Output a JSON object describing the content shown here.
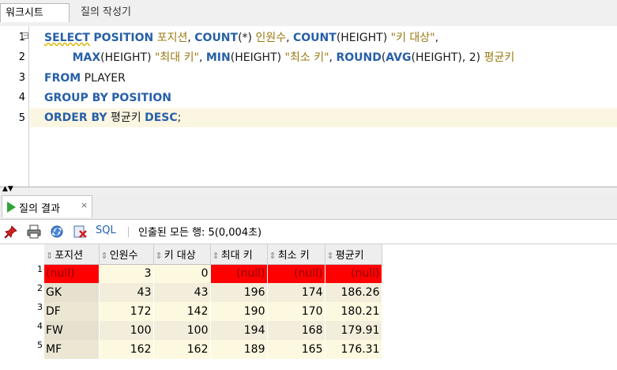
{
  "tabs": {
    "worksheet": "워크시트",
    "query_builder": "질의 작성기"
  },
  "editor": {
    "line_numbers": [
      "1",
      "2",
      "3",
      "4",
      "5"
    ],
    "lines": [
      [
        {
          "t": "SELECT",
          "c": "kw"
        },
        {
          "t": " ",
          "c": "txt"
        },
        {
          "t": "POSITION",
          "c": "kw"
        },
        {
          "t": " 포지션",
          "c": "str"
        },
        {
          "t": ", ",
          "c": "txt"
        },
        {
          "t": "COUNT",
          "c": "fn"
        },
        {
          "t": "(*) ",
          "c": "txt"
        },
        {
          "t": "인원수",
          "c": "str"
        },
        {
          "t": ", ",
          "c": "txt"
        },
        {
          "t": "COUNT",
          "c": "fn"
        },
        {
          "t": "(HEIGHT) ",
          "c": "txt"
        },
        {
          "t": "\"키 대상\"",
          "c": "str"
        },
        {
          "t": ",",
          "c": "txt"
        }
      ],
      [
        {
          "t": "        ",
          "c": "txt"
        },
        {
          "t": "MAX",
          "c": "fn"
        },
        {
          "t": "(HEIGHT) ",
          "c": "txt"
        },
        {
          "t": "\"최대 키\"",
          "c": "str"
        },
        {
          "t": ", ",
          "c": "txt"
        },
        {
          "t": "MIN",
          "c": "fn"
        },
        {
          "t": "(HEIGHT) ",
          "c": "txt"
        },
        {
          "t": "\"최소 키\"",
          "c": "str"
        },
        {
          "t": ", ",
          "c": "txt"
        },
        {
          "t": "ROUND",
          "c": "fn"
        },
        {
          "t": "(",
          "c": "txt"
        },
        {
          "t": "AVG",
          "c": "fn"
        },
        {
          "t": "(HEIGHT), 2) ",
          "c": "txt"
        },
        {
          "t": "평균키",
          "c": "str"
        }
      ],
      [
        {
          "t": "FROM",
          "c": "kw"
        },
        {
          "t": " PLAYER",
          "c": "txt"
        }
      ],
      [
        {
          "t": "GROUP BY",
          "c": "kw"
        },
        {
          "t": " ",
          "c": "txt"
        },
        {
          "t": "POSITION",
          "c": "kw"
        }
      ],
      [
        {
          "t": "ORDER BY",
          "c": "kw"
        },
        {
          "t": " 평균키 ",
          "c": "txt"
        },
        {
          "t": "DESC",
          "c": "kw"
        },
        {
          "t": ";",
          "c": "txt"
        }
      ]
    ]
  },
  "results": {
    "tab_label": "질의 결과",
    "close_glyph": "×",
    "toolbar": {
      "sql_label": "SQL",
      "divider": "|",
      "fetch_text": "인출된 모든 행: 5(0,004초)"
    },
    "sort_glyph": "⇕",
    "columns": [
      "포지션",
      "인원수",
      "키 대상",
      "최대 키",
      "최소 키",
      "평균키"
    ],
    "rows": [
      {
        "n": "1",
        "cells": [
          "(null)",
          "3",
          "0",
          "(null)",
          "(null)",
          "(null)"
        ]
      },
      {
        "n": "2",
        "cells": [
          "GK",
          "43",
          "43",
          "196",
          "174",
          "186.26"
        ]
      },
      {
        "n": "3",
        "cells": [
          "DF",
          "172",
          "142",
          "190",
          "170",
          "180.21"
        ]
      },
      {
        "n": "4",
        "cells": [
          "FW",
          "100",
          "100",
          "194",
          "168",
          "179.91"
        ]
      },
      {
        "n": "5",
        "cells": [
          "MF",
          "162",
          "162",
          "189",
          "165",
          "176.31"
        ]
      }
    ],
    "null_color": "#ff0000"
  }
}
